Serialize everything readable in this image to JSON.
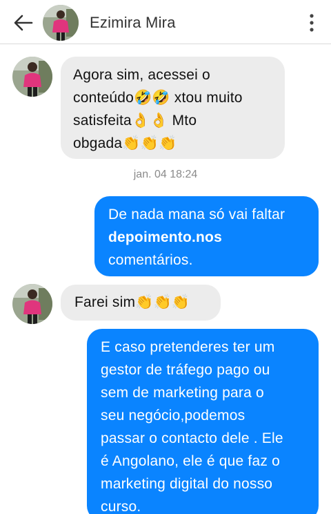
{
  "header": {
    "contact_name": "Ezimira Mira"
  },
  "messages": [
    {
      "direction": "incoming",
      "lines": [
        "Agora sim, acessei o",
        "conteúdo🤣🤣 xtou muito",
        "satisfeita👌👌 Mto",
        "obgada👏👏👏"
      ]
    },
    {
      "direction": "outgoing",
      "lines": [
        "De nada mana só vai faltar",
        "depoimento.nos",
        "comentários."
      ]
    },
    {
      "direction": "incoming",
      "lines": [
        "Farei sim👏👏👏"
      ]
    },
    {
      "direction": "outgoing",
      "lines": [
        "E caso pretenderes ter um",
        "gestor de tráfego pago ou",
        "sem de marketing para o",
        "seu negócio,podemos",
        "passar o contacto dele . Ele",
        "é Angolano, ele é que faz o",
        "marketing digital do nosso",
        "curso."
      ]
    }
  ],
  "timestamp": "jan. 04 18:24",
  "colors": {
    "outgoing_bubble": "#0a84ff",
    "incoming_bubble": "#ececec"
  },
  "icons": {
    "back": "arrow-left",
    "menu": "vertical-ellipsis",
    "avatar": "profile-photo"
  }
}
